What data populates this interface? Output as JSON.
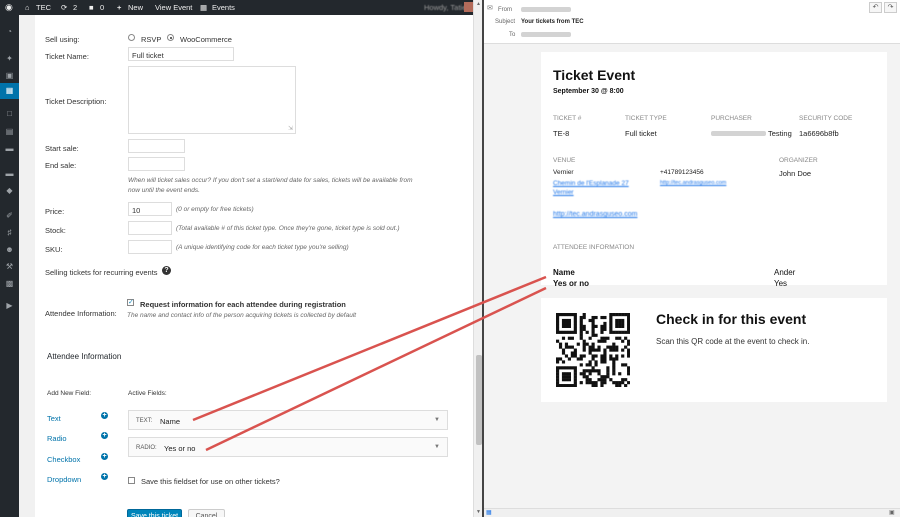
{
  "admin_bar": {
    "site": "TEC",
    "updates": "2",
    "comments": "0",
    "new": "New",
    "view_event": "View Event",
    "events": "Events",
    "howdy": "Howdy, Tatiec"
  },
  "form": {
    "sell_using_label": "Sell using:",
    "rsvp_label": "RSVP",
    "woocommerce_label": "WooCommerce",
    "ticket_name_label": "Ticket Name:",
    "ticket_name_value": "Full ticket",
    "ticket_description_label": "Ticket Description:",
    "start_sale_label": "Start sale:",
    "end_sale_label": "End sale:",
    "sale_hint_1": "When will ticket sales occur? If you don't set a start/end date for sales, tickets will be available from",
    "sale_hint_2": "now until the event ends.",
    "price_label": "Price:",
    "price_value": "10",
    "price_hint": "(0 or empty for free tickets)",
    "stock_label": "Stock:",
    "stock_hint": "(Total available # of this ticket type. Once they're gone, ticket type is sold out.)",
    "sku_label": "SKU:",
    "sku_hint": "(A unique identifying code for each ticket type you're selling)",
    "recurring_label": "Selling tickets for recurring events",
    "attendee_info_label": "Attendee Information:",
    "request_info_label": "Request information for each attendee during registration",
    "request_info_hint": "The name and contact info of the person acquiring tickets is collected by default",
    "attendee_section_title": "Attendee Information",
    "add_new_field_label": "Add New Field:",
    "active_fields_label": "Active Fields:",
    "field_types": [
      "Text",
      "Radio",
      "Checkbox",
      "Dropdown"
    ],
    "active_fields": [
      {
        "type": "TEXT:",
        "name": "Name"
      },
      {
        "type": "RADIO:",
        "name": "Yes or no"
      }
    ],
    "save_fieldset_label": "Save this fieldset for use on other tickets?",
    "save_button": "Save this ticket",
    "cancel_button": "Cancel"
  },
  "email": {
    "from_label": "From",
    "subject_label": "Subject",
    "subject_value": "Your tickets from TEC",
    "to_label": "To",
    "ticket": {
      "title": "Ticket Event",
      "date": "September 30 @ 8:00",
      "ticket_no_label": "TICKET #",
      "ticket_no_value": "TE-8",
      "ticket_type_label": "TICKET TYPE",
      "ticket_type_value": "Full ticket",
      "purchaser_label": "PURCHASER",
      "purchaser_value": "Testing",
      "security_label": "SECURITY CODE",
      "security_value": "1a6696b8fb",
      "venue_label": "VENUE",
      "venue_value": "Vernier",
      "phone_value": "+41789123456",
      "organizer_label": "ORGANIZER",
      "organizer_value": "John Doe",
      "address_1": "Chemin de l'Esplanade 27",
      "address_2": "Vernier",
      "venue_url": "http://tec.andrasguseo.com",
      "attendee_info_label": "ATTENDEE INFORMATION",
      "answers": [
        {
          "q": "Name",
          "a": "Ander"
        },
        {
          "q": "Yes or no",
          "a": "Yes"
        }
      ]
    },
    "checkin": {
      "title": "Check in for this event",
      "text": "Scan this QR code at the event to check in."
    }
  },
  "colors": {
    "admin_bg": "#23282d",
    "accent": "#0073aa",
    "annotation": "#d9534f"
  }
}
